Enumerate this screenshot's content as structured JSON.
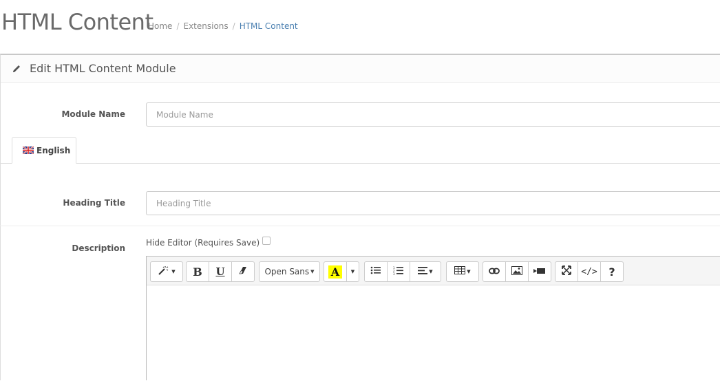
{
  "header": {
    "title": "HTML Content",
    "breadcrumb": [
      {
        "label": "Home"
      },
      {
        "label": "Extensions"
      },
      {
        "label": "HTML Content"
      }
    ],
    "separator": "/"
  },
  "panel": {
    "title": "Edit HTML Content Module",
    "title_icon": "pencil-icon"
  },
  "form": {
    "module_name": {
      "label": "Module Name",
      "placeholder": "Module Name",
      "value": ""
    },
    "language_tab": {
      "label": "English",
      "icon": "uk-flag-icon"
    },
    "heading_title": {
      "label": "Heading Title",
      "placeholder": "Heading Title",
      "value": ""
    },
    "description": {
      "label": "Description"
    },
    "hide_editor": {
      "label": "Hide Editor (Requires Save)",
      "checked": false
    }
  },
  "editor_toolbar": {
    "style_icon": "magic-wand-icon",
    "bold_label": "B",
    "underline_label": "U",
    "eraser_icon": "eraser-icon",
    "font_name": "Open Sans",
    "color_label": "A",
    "color_highlight": "#ffff00",
    "unordered_list_icon": "unordered-list-icon",
    "ordered_list_icon": "ordered-list-icon",
    "paragraph_icon": "align-left-icon",
    "table_icon": "table-icon",
    "link_icon": "link-icon",
    "image_icon": "image-icon",
    "video_icon": "video-icon",
    "fullscreen_icon": "fullscreen-icon",
    "code_label": "</>",
    "help_label": "?"
  },
  "colors": {
    "breadcrumb_active": "#4a7fb0",
    "title": "#6a6a6a"
  }
}
